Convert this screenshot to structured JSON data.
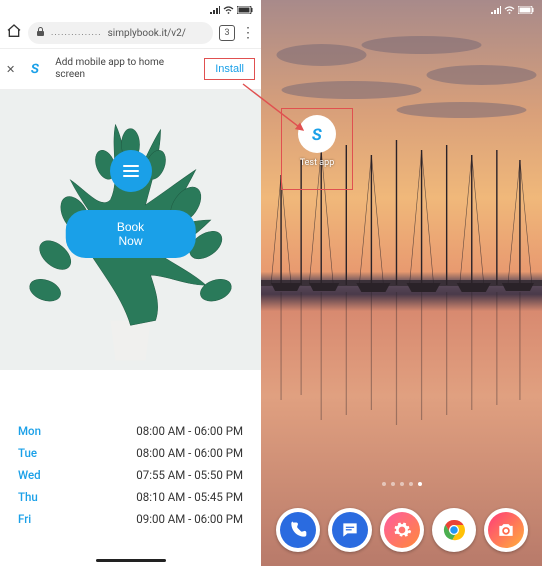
{
  "left": {
    "status": {
      "signal": "▮▮▯",
      "wifi": "wifi",
      "battery": "batt"
    },
    "browser": {
      "url_prefix": "...............",
      "url_text": "simplybook.it/v2/",
      "tab_count": "3"
    },
    "install_banner": {
      "text": "Add mobile app to home screen",
      "button": "Install"
    },
    "hero": {
      "book_button": "Book Now"
    },
    "hours": [
      {
        "day": "Mon",
        "time": "08:00 AM - 06:00 PM"
      },
      {
        "day": "Tue",
        "time": "08:00 AM - 06:00 PM"
      },
      {
        "day": "Wed",
        "time": "07:55 AM - 05:50 PM"
      },
      {
        "day": "Thu",
        "time": "08:10 AM - 05:45 PM"
      },
      {
        "day": "Fri",
        "time": "09:00 AM - 06:00 PM"
      }
    ]
  },
  "right": {
    "status": {
      "signal": "▮▮▯",
      "wifi": "wifi",
      "battery": "batt"
    },
    "app_icon": {
      "glyph": "S",
      "label": "Test app"
    },
    "dock": [
      {
        "name": "phone",
        "bg": "#2a6be0",
        "glyph": "phone"
      },
      {
        "name": "messages",
        "bg": "#2a6be0",
        "glyph": "chat"
      },
      {
        "name": "settings",
        "bg": "#e84aa0",
        "glyph": "gear"
      },
      {
        "name": "chrome",
        "bg": "#ffffff",
        "glyph": "chrome"
      },
      {
        "name": "camera",
        "bg": "#ffffff",
        "glyph": "camera",
        "grad": true
      }
    ]
  },
  "colors": {
    "accent": "#1aa0e8",
    "highlight": "#e05050"
  }
}
